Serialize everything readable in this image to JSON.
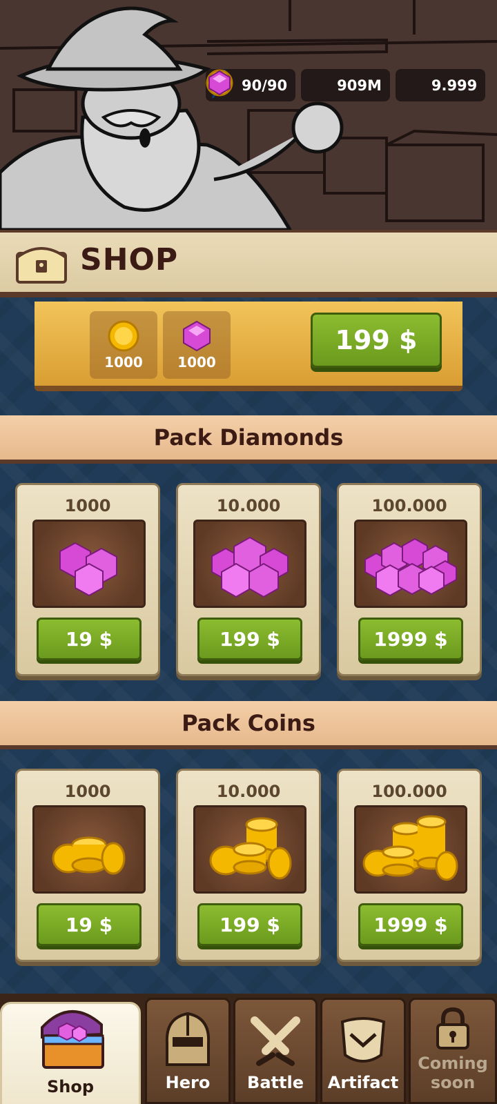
{
  "currencies": {
    "energy": {
      "value": "90/90",
      "icon": "lightning-icon"
    },
    "coins": {
      "value": "909M",
      "icon": "coin-icon"
    },
    "gems": {
      "value": "9.999",
      "icon": "gem-icon"
    }
  },
  "header": {
    "title": "SHOP"
  },
  "bundle": {
    "items": [
      {
        "amount": "1000",
        "icon": "coin-icon"
      },
      {
        "amount": "1000",
        "icon": "gem-icon"
      }
    ],
    "price": "199 $"
  },
  "diamonds": {
    "title": "Pack Diamonds",
    "packs": [
      {
        "amount": "1000",
        "price": "19 $"
      },
      {
        "amount": "10.000",
        "price": "199 $"
      },
      {
        "amount": "100.000",
        "price": "1999 $"
      }
    ]
  },
  "coins": {
    "title": "Pack Coins",
    "packs": [
      {
        "amount": "1000",
        "price": "19 $"
      },
      {
        "amount": "10.000",
        "price": "199 $"
      },
      {
        "amount": "100.000",
        "price": "1999 $"
      }
    ]
  },
  "nav": {
    "tabs": [
      {
        "label": "Shop",
        "active": true
      },
      {
        "label": "Hero"
      },
      {
        "label": "Battle"
      },
      {
        "label": "Artifact"
      },
      {
        "label": "Coming soon",
        "disabled": true
      }
    ]
  },
  "colors": {
    "accent_green": "#7aa825",
    "gem_purple": "#d64ad6",
    "coin_gold": "#f5b800",
    "background_navy": "#203b57"
  }
}
